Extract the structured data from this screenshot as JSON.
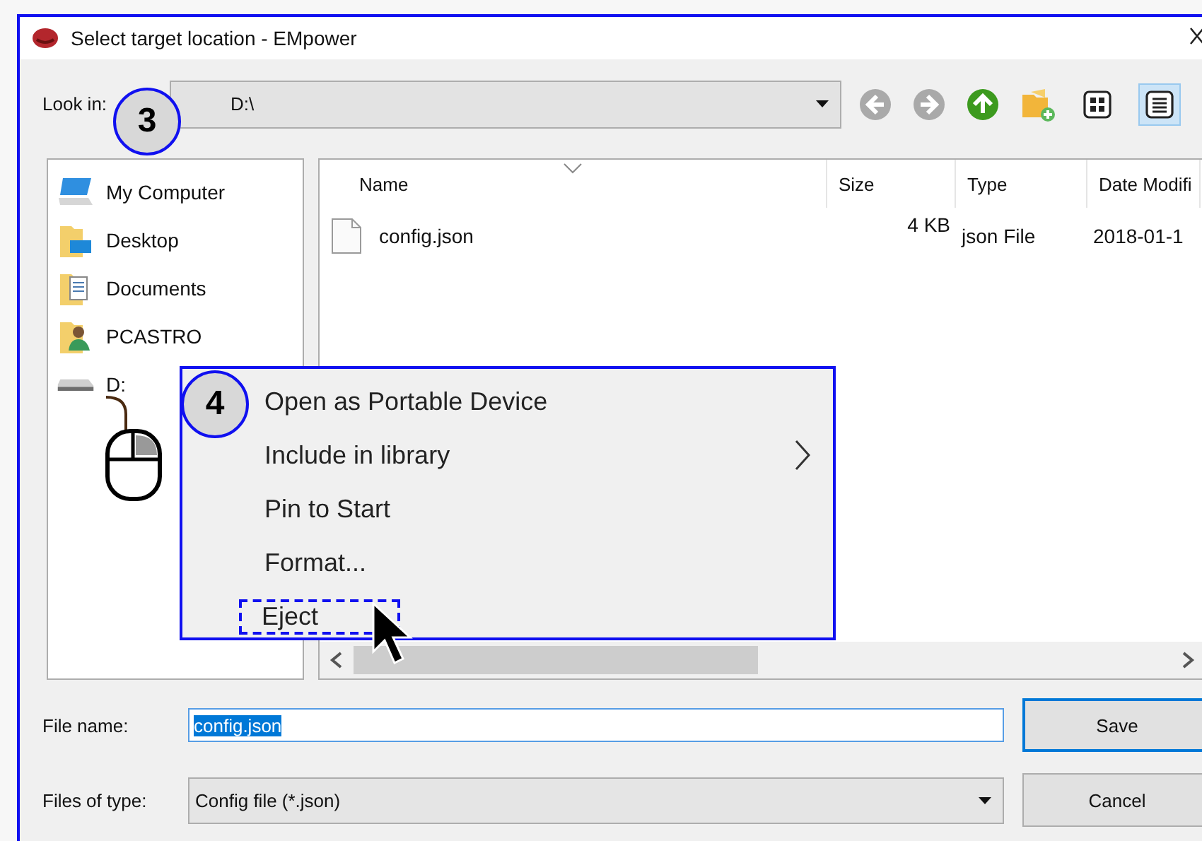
{
  "window": {
    "title": "Select target location - EMpower"
  },
  "annotations": [
    {
      "label": "3"
    },
    {
      "label": "4"
    }
  ],
  "look_in": {
    "label": "Look in:",
    "value": "D:\\"
  },
  "view_buttons": [
    {
      "kind": "icons",
      "selected": false
    },
    {
      "kind": "details",
      "selected": true
    }
  ],
  "sidebar": {
    "items": [
      {
        "label": "My Computer",
        "kind": "computer"
      },
      {
        "label": "Desktop",
        "kind": "desktop"
      },
      {
        "label": "Documents",
        "kind": "documents"
      },
      {
        "label": "PCASTRO",
        "kind": "user"
      },
      {
        "label": "D:",
        "kind": "drive"
      }
    ]
  },
  "file_list": {
    "columns": [
      "Name",
      "Size",
      "Type",
      "Date Modifi"
    ],
    "rows": [
      {
        "name": "config.json",
        "size": "4 KB",
        "type": "json File",
        "date": "2018-01-1"
      }
    ]
  },
  "context_menu": {
    "items": [
      {
        "label": "Open as Portable Device",
        "submenu": false,
        "focused": false
      },
      {
        "label": "Include in library",
        "submenu": true,
        "focused": false
      },
      {
        "label": "Pin to Start",
        "submenu": false,
        "focused": false
      },
      {
        "label": "Format...",
        "submenu": false,
        "focused": false
      },
      {
        "label": "Eject",
        "submenu": false,
        "focused": true
      }
    ]
  },
  "file_name": {
    "label": "File name:",
    "value": "config.json",
    "text_selected": true
  },
  "file_type": {
    "label": "Files of type:",
    "value": "Config file (*.json)"
  },
  "buttons": [
    {
      "label": "Save",
      "default": true
    },
    {
      "label": "Cancel",
      "default": false
    }
  ]
}
